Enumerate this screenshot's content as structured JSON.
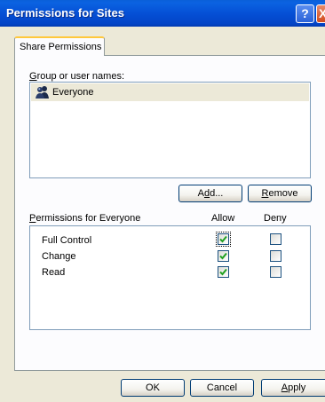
{
  "window": {
    "title": "Permissions for Sites",
    "help_glyph": "?",
    "close_glyph": "X"
  },
  "tabs": [
    {
      "label": "Share Permissions",
      "active": true
    }
  ],
  "group_section": {
    "label_accel": "G",
    "label_rest": "roup or user names:",
    "users": [
      {
        "name": "Everyone",
        "icon": "users-group-icon",
        "selected": true
      }
    ]
  },
  "buttons": {
    "add_pre": "A",
    "add_accel": "d",
    "add_post": "d...",
    "remove_accel": "R",
    "remove_post": "emove",
    "ok": "OK",
    "cancel": "Cancel",
    "apply_accel": "A",
    "apply_post": "pply"
  },
  "permissions": {
    "header_accel": "P",
    "header_rest": "ermissions for Everyone",
    "allow_header": "Allow",
    "deny_header": "Deny",
    "rows": [
      {
        "name": "Full Control",
        "allow": true,
        "deny": false
      },
      {
        "name": "Change",
        "allow": true,
        "deny": false
      },
      {
        "name": "Read",
        "allow": true,
        "deny": false
      }
    ]
  },
  "colors": {
    "title_bar": "#0550d6",
    "dialog_bg": "#ece9d8",
    "tab_highlight": "#ffc83c",
    "check_mark": "#21a121",
    "checkbox_border": "#1c5180"
  }
}
